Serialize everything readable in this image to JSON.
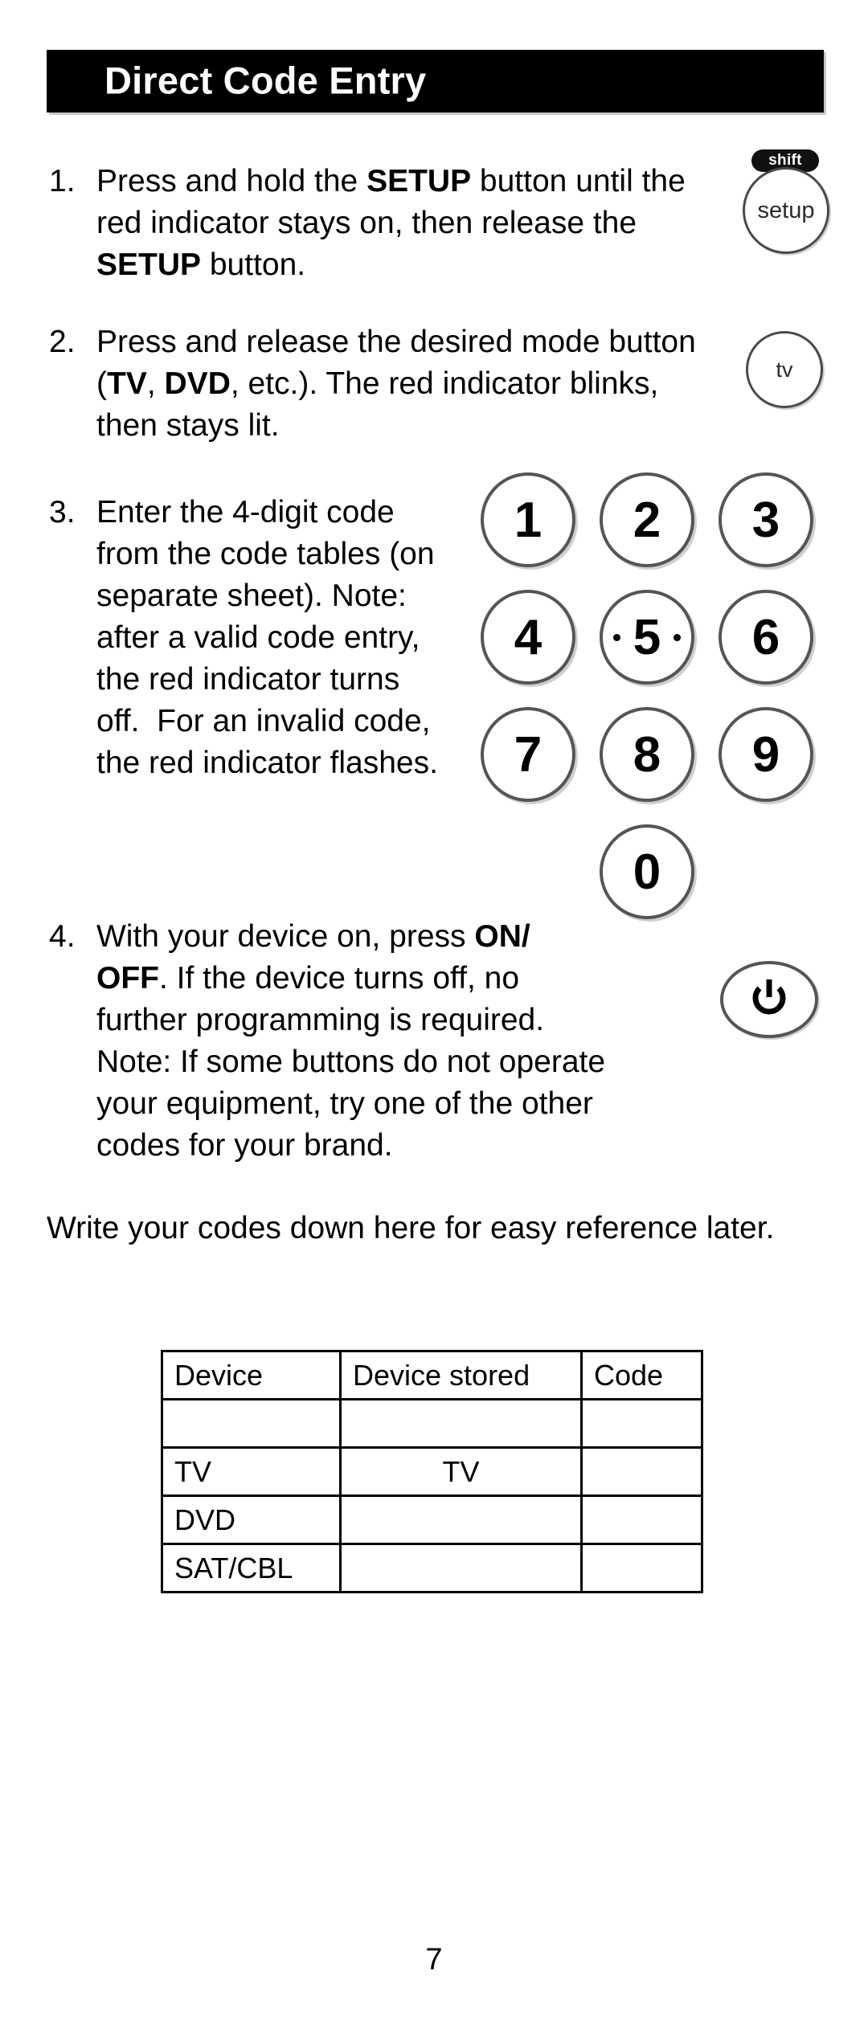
{
  "page": {
    "title": "Direct Code Entry",
    "number": "7"
  },
  "steps": [
    {
      "num": "1.",
      "html": "Press and hold the <b>SETUP</b> button until the red indicator stays on, then release the <b>SETUP</b> button.",
      "text": "Press and hold the SETUP button until the red indicator stays on, then release the SETUP button."
    },
    {
      "num": "2.",
      "html": "Press and release the desired mode button (<b>TV</b>, <b>DVD</b>, etc.). The red indicator blinks, then stays lit.",
      "text": "Press and release the desired mode button (TV, DVD, etc.). The red indicator blinks, then stays lit."
    },
    {
      "num": "3.",
      "html": "Enter the 4-digit code from the code tables (on separate sheet). Note: after a valid code entry, the red indicator turns off.&nbsp; For an invalid code, the red indicator flashes.",
      "text": "Enter the 4-digit code from the code tables (on separate sheet). Note: after a valid code entry, the red indicator turns off.  For an invalid code, the red indicator flashes."
    },
    {
      "num": "4.",
      "html": "With your device on, press <b>ON/ OFF</b>. If the device turns off, no further programming is required. Note: If some buttons do not operate your equipment, try one of the other codes for your brand.",
      "text": "With your device on, press ON/OFF. If the device turns off, no further programming is required. Note: If some buttons do not operate your equipment, try one of the other codes for your brand."
    }
  ],
  "note_paragraph": "Write your codes down here for easy reference later.",
  "remote_buttons": {
    "shift_label": "shift",
    "setup_label": "setup",
    "tv_label": "tv",
    "power_label": "power"
  },
  "keypad": {
    "keys": [
      "1",
      "2",
      "3",
      "4",
      "5",
      "6",
      "7",
      "8",
      "9",
      "0"
    ],
    "tactile_key": "5"
  },
  "table": {
    "headers": [
      "Device",
      "Device stored",
      "Code"
    ],
    "rows": [
      {
        "device": "",
        "stored": "",
        "code": ""
      },
      {
        "device": "TV",
        "stored": "TV",
        "code": ""
      },
      {
        "device": "DVD",
        "stored": "",
        "code": ""
      },
      {
        "device": "SAT/CBL",
        "stored": "",
        "code": ""
      }
    ]
  },
  "colors": {
    "title_bar_bg": "#000000",
    "title_bar_text": "#ffffff",
    "body_text": "#000000",
    "button_outline": "#555555",
    "page_bg": "#ffffff"
  }
}
